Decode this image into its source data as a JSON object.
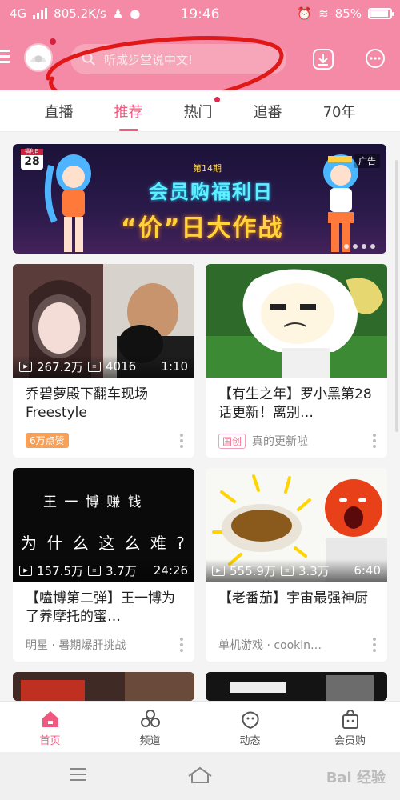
{
  "status_bar": {
    "network": "4G",
    "speed": "805.2K/s",
    "time": "19:46",
    "battery": "85%"
  },
  "header": {
    "search_placeholder": "听成步堂说中文!",
    "colors": {
      "bg": "#f48aa6",
      "accent": "#f0597f"
    }
  },
  "tabs": [
    {
      "label": "直播"
    },
    {
      "label": "推荐"
    },
    {
      "label": "热门"
    },
    {
      "label": "追番"
    },
    {
      "label": "70年"
    }
  ],
  "banner": {
    "date_day": "28",
    "date_month": "福利日",
    "issue": "第14期",
    "line1": "会员购福利日",
    "line2": "“价”日大作战",
    "ad_label": "广告"
  },
  "cards": [
    {
      "views": "267.2万",
      "danmaku": "4016",
      "duration": "1:10",
      "title": "乔碧萝殿下翻车现场Freestyle",
      "badge": "6万点赞",
      "badge_type": "orange",
      "tag": ""
    },
    {
      "views": "",
      "danmaku": "",
      "duration": "",
      "title": "【有生之年】罗小黑第28话更新！离别…",
      "badge": "国创",
      "badge_type": "pink",
      "tag": "真的更新啦"
    },
    {
      "views": "157.5万",
      "danmaku": "3.7万",
      "duration": "24:26",
      "title": "【嗑博第二弹】王一博为了养摩托的蜜…",
      "badge": "",
      "badge_type": "",
      "tag": "明星 · 暑期爆肝挑战",
      "thumb_text_1": "王 一 博 赚 钱",
      "thumb_text_2": "为 什 么 这 么 难 ?"
    },
    {
      "views": "555.9万",
      "danmaku": "3.3万",
      "duration": "6:40",
      "title": "【老番茄】宇宙最强神厨",
      "badge": "",
      "badge_type": "",
      "tag": "单机游戏 · cookin…"
    }
  ],
  "bottom_nav": [
    {
      "label": "首页"
    },
    {
      "label": "频道"
    },
    {
      "label": "动态"
    },
    {
      "label": "会员购"
    }
  ],
  "watermark": "Bai 经验"
}
